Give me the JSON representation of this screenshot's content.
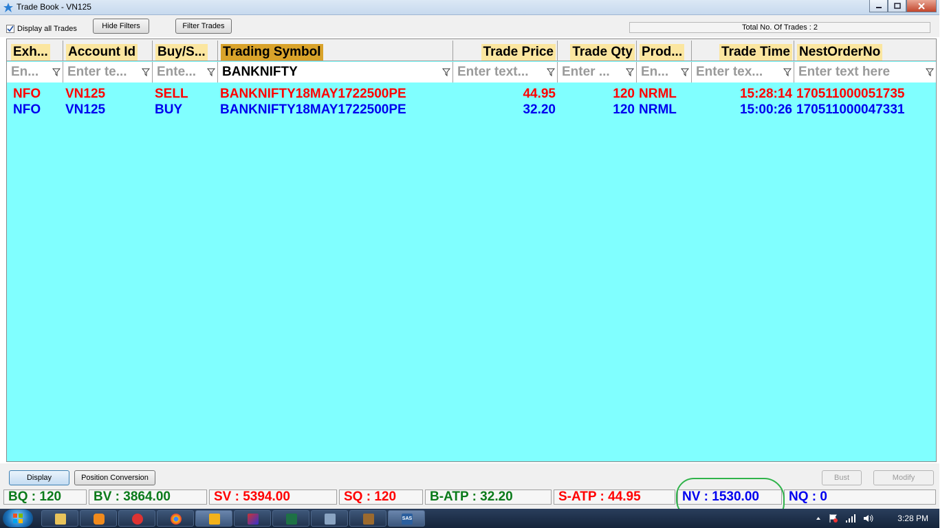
{
  "window": {
    "title": "Trade Book - VN125"
  },
  "toolbar": {
    "display_all_label": "Display all Trades",
    "display_all_checked": true,
    "hide_filters": "Hide Filters",
    "filter_trades": "Filter Trades",
    "total_trades": "Total No. Of Trades : 2"
  },
  "columns": [
    {
      "label": "Exh...",
      "filter": "En...",
      "filter_value": false
    },
    {
      "label": "Account Id",
      "filter": "Enter te...",
      "filter_value": false
    },
    {
      "label": "Buy/S...",
      "filter": "Ente...",
      "filter_value": false
    },
    {
      "label": "Trading Symbol",
      "filter": "BANKNIFTY",
      "filter_value": true
    },
    {
      "label": "Trade Price",
      "filter": "Enter text...",
      "filter_value": false
    },
    {
      "label": "Trade Qty",
      "filter": "Enter ...",
      "filter_value": false
    },
    {
      "label": "Prod...",
      "filter": "En...",
      "filter_value": false
    },
    {
      "label": "Trade Time",
      "filter": "Enter tex...",
      "filter_value": false
    },
    {
      "label": "NestOrderNo",
      "filter": "Enter text here",
      "filter_value": false
    }
  ],
  "rows": [
    {
      "side": "sell",
      "exchange": "NFO",
      "account": "VN125",
      "buy_sell": "SELL",
      "symbol": "BANKNIFTY18MAY1722500PE",
      "price": "44.95",
      "qty": "120",
      "product": "NRML",
      "time": "15:28:14",
      "order_no": "170511000051735"
    },
    {
      "side": "buy",
      "exchange": "NFO",
      "account": "VN125",
      "buy_sell": "BUY",
      "symbol": "BANKNIFTY18MAY1722500PE",
      "price": "32.20",
      "qty": "120",
      "product": "NRML",
      "time": "15:00:26",
      "order_no": "170511000047331"
    }
  ],
  "actions": {
    "display": "Display",
    "position_conversion": "Position Conversion",
    "bust": "Bust",
    "modify": "Modify"
  },
  "summary": {
    "bq": "BQ : 120",
    "bv": "BV : 3864.00",
    "sv": "SV : 5394.00",
    "sq": "SQ : 120",
    "b_atp": "B-ATP : 32.20",
    "s_atp": "S-ATP : 44.95",
    "nv": "NV : 1530.00",
    "nq": "NQ : 0"
  },
  "taskbar": {
    "clock": "3:28 PM",
    "active_app": "SAS"
  },
  "colors": {
    "grid_bg": "#80ffff",
    "sell": "#ff0000",
    "buy": "#0000ee",
    "header_label": "#fbe6a0",
    "header_active": "#d9a32a",
    "summary_green": "#0a7a1a"
  }
}
